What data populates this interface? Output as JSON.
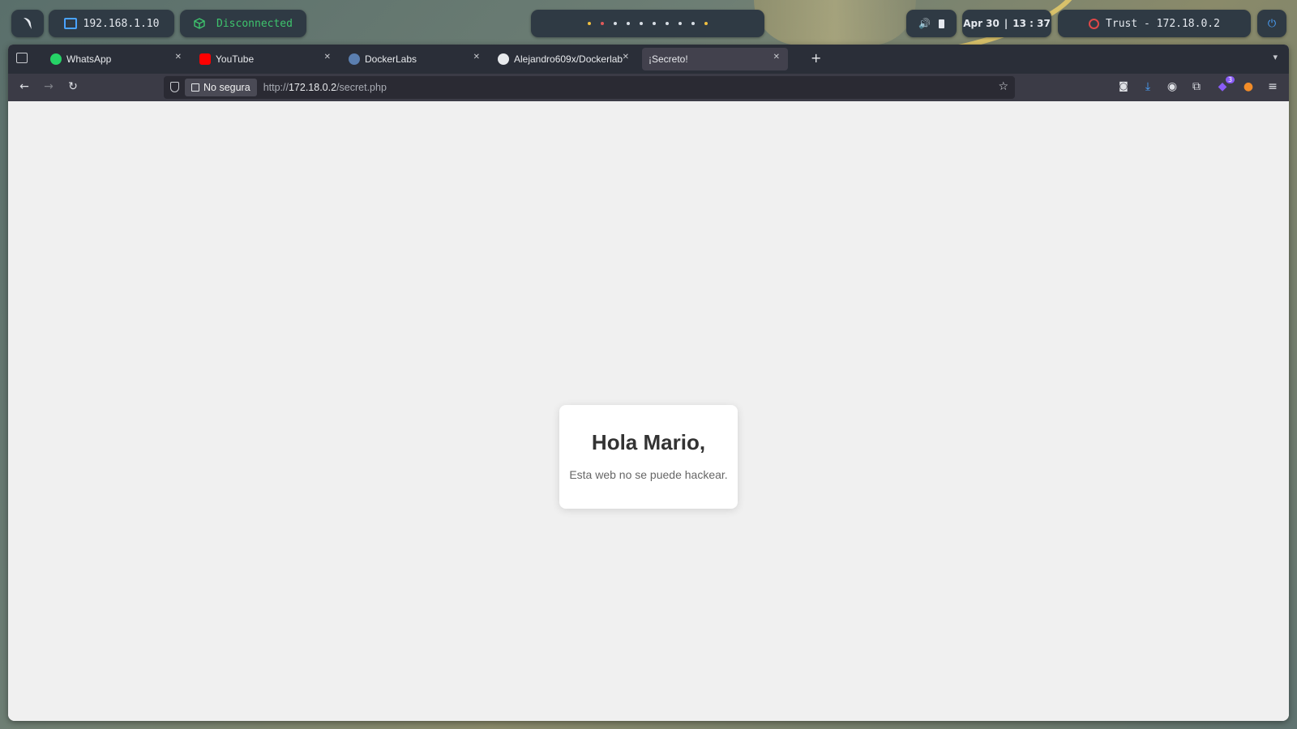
{
  "topbar": {
    "ip": "192.168.1.10",
    "vpn_status": "Disconnected",
    "date": "Apr 30",
    "time": "13 : 37",
    "target": "Trust - 172.18.0.2",
    "workspace_dot_colors": [
      "#f0c040",
      "#e05a5a",
      "#d7dde4",
      "#d7dde4",
      "#d7dde4",
      "#d7dde4",
      "#d7dde4",
      "#d7dde4",
      "#d7dde4",
      "#f0c040"
    ]
  },
  "browser": {
    "tabs": [
      {
        "label": "WhatsApp",
        "icon": "whatsapp-icon",
        "color": "#25d366"
      },
      {
        "label": "YouTube",
        "icon": "youtube-icon",
        "color": "#ff0000"
      },
      {
        "label": "DockerLabs",
        "icon": "dockerlabs-icon",
        "color": "#5b7fb0"
      },
      {
        "label": "Alejandro609x/Dockerlab",
        "icon": "github-icon",
        "color": "#ffffff"
      },
      {
        "label": "¡Secreto!",
        "icon": "",
        "color": ""
      }
    ],
    "security_label": "No segura",
    "url_prefix": "http://",
    "url_host": "172.18.0.2",
    "url_path": "/secret.php",
    "extension_badge": "3"
  },
  "page": {
    "heading": "Hola Mario,",
    "message": "Esta web no se puede hackear."
  }
}
